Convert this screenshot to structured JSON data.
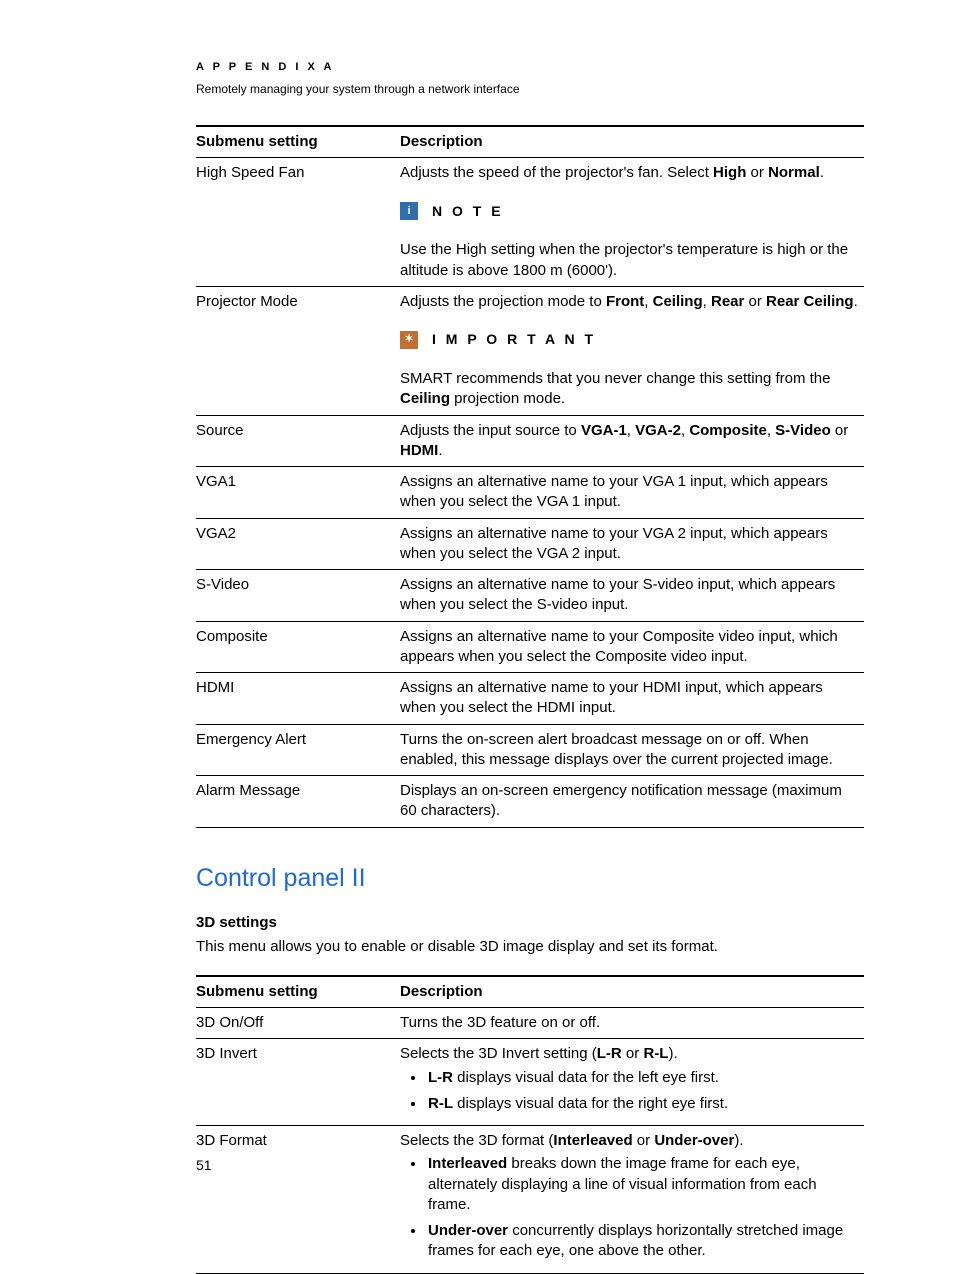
{
  "header": {
    "appendix": "A P P E N D I X   A",
    "subtitle": "Remotely managing your system through a network interface"
  },
  "table1": {
    "col1": "Submenu setting",
    "col2": "Description",
    "rows": {
      "high_speed_fan": {
        "name": "High Speed Fan",
        "desc_pre": "Adjusts the speed of the projector's fan. Select ",
        "opt1": "High",
        "or": " or ",
        "opt2": "Normal",
        "desc_post": ".",
        "note_label": "N O T E",
        "note_body": "Use the High setting when the projector's temperature is high or the altitude is above 1800 m (6000')."
      },
      "projector_mode": {
        "name": "Projector Mode",
        "pre": "Adjusts the projection mode to ",
        "o1": "Front",
        "c1": ", ",
        "o2": "Ceiling",
        "c2": ", ",
        "o3": "Rear",
        "or": " or ",
        "o4": "Rear Ceiling",
        "post": ".",
        "imp_label": "I M P O R T A N T",
        "imp_pre": "SMART recommends that you never change this setting from the ",
        "imp_bold": "Ceiling",
        "imp_post": " projection mode."
      },
      "source": {
        "name": "Source",
        "pre": "Adjusts the input source to ",
        "o1": "VGA-1",
        "c1": ", ",
        "o2": "VGA-2",
        "c2": ", ",
        "o3": "Composite",
        "c3": ", ",
        "o4": "S-Video",
        "or": " or ",
        "o5": "HDMI",
        "post": "."
      },
      "vga1": {
        "name": "VGA1",
        "desc": "Assigns an alternative name to your VGA 1 input, which appears when you select the VGA 1 input."
      },
      "vga2": {
        "name": "VGA2",
        "desc": "Assigns an alternative name to your VGA 2 input, which appears when you select the VGA 2 input."
      },
      "svideo": {
        "name": "S-Video",
        "desc": "Assigns an alternative name to your S-video input, which appears when you select the S-video input."
      },
      "composite": {
        "name": "Composite",
        "desc": "Assigns an alternative name to your Composite video input, which appears when you select the Composite video input."
      },
      "hdmi": {
        "name": "HDMI",
        "desc": "Assigns an alternative name to your HDMI input, which appears when you select the HDMI input."
      },
      "emerg": {
        "name": "Emergency Alert",
        "desc": "Turns the on-screen alert broadcast message on or off. When enabled, this message displays over the current projected image."
      },
      "alarm": {
        "name": "Alarm Message",
        "desc": "Displays an on-screen emergency notification message (maximum 60 characters)."
      }
    }
  },
  "section2": {
    "heading": "Control panel II",
    "sub": "3D settings",
    "intro": "This menu allows you to enable or disable 3D image display and set its format."
  },
  "table2": {
    "col1": "Submenu setting",
    "col2": "Description",
    "onoff": {
      "name": "3D On/Off",
      "desc": "Turns the 3D feature on or off."
    },
    "invert": {
      "name": "3D Invert",
      "pre": "Selects the 3D Invert setting (",
      "o1": "L-R",
      "or": " or ",
      "o2": "R-L",
      "post": ").",
      "li1b": "L-R",
      "li1": " displays visual data for the left eye first.",
      "li2b": "R-L",
      "li2": " displays visual data for the right eye first."
    },
    "format": {
      "name": "3D Format",
      "pre": "Selects the 3D format (",
      "o1": "Interleaved",
      "or": " or ",
      "o2": "Under-over",
      "post": ").",
      "li1b": "Interleaved",
      "li1": " breaks down the image frame for each eye, alternately displaying a line of visual information from each frame.",
      "li2b": "Under-over",
      "li2": " concurrently displays horizontally stretched image frames for each eye, one above the other."
    }
  },
  "page_number": "51"
}
